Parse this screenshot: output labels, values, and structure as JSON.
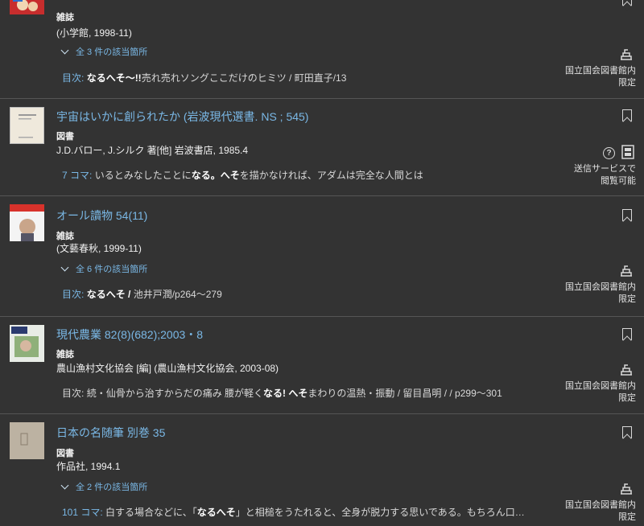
{
  "results": [
    {
      "type": "雑誌",
      "publisher": "(小学館, 1998-11)",
      "expand": "全 3 件の該当箇所",
      "snippet": {
        "label": "目次:",
        "bold": "なるへそ〜!!",
        "rest": "売れ売れソングここだけのヒミツ / 町田直子/13"
      },
      "access": [
        "国立国会図書館内",
        "限定"
      ],
      "access_icon": "library-building-icon"
    },
    {
      "title": "宇宙はいかに創られたか (岩波現代選書. NS ; 545)",
      "type": "図書",
      "publisher": "J.D.バロー, J.シルク 著[他] 岩波書店, 1985.4",
      "snippet": {
        "label": "7 コマ:",
        "pre": "いるとみなしたことに",
        "bold": "なる。へそ",
        "rest": "を描かなければ、アダムは完全な人間とは"
      },
      "help": "?",
      "access": [
        "送信サービスで",
        "閲覧可能"
      ],
      "access_icon": "transmission-service-icon"
    },
    {
      "title": "オール讀物 54(11)",
      "type": "雑誌",
      "publisher": "(文藝春秋, 1999-11)",
      "expand": "全 6 件の該当箇所",
      "snippet": {
        "label": "目次:",
        "bold": "なるへそ /",
        "rest": "池井戸潤/p264〜279"
      },
      "access": [
        "国立国会図書館内",
        "限定"
      ],
      "access_icon": "library-building-icon"
    },
    {
      "title": "現代農業 82(8)(682);2003・8",
      "type": "雑誌",
      "publisher": "農山漁村文化協会 [編] (農山漁村文化協会, 2003-08)",
      "snippet": {
        "label": "目次:",
        "pre": "続・仙骨から治すからだの痛み 腰が軽く",
        "bold": "なる! へそ",
        "rest": "まわりの温熱・振動 / 留目昌明 / / p299〜301"
      },
      "access": [
        "国立国会図書館内",
        "限定"
      ],
      "access_icon": "library-building-icon"
    },
    {
      "title": "日本の名随筆 別巻 35",
      "type": "図書",
      "publisher": "作品社, 1994.1",
      "expand": "全 2 件の該当箇所",
      "snippet": {
        "label": "101 コマ:",
        "pre": "白する場合などに、「",
        "bold": "なるへそ",
        "rest": "」と相槌をうたれると、全身が脱力する思いである。もちろん口…"
      },
      "access": [
        "国立国会図書館内",
        "限定"
      ],
      "access_icon": "library-building-icon"
    }
  ]
}
